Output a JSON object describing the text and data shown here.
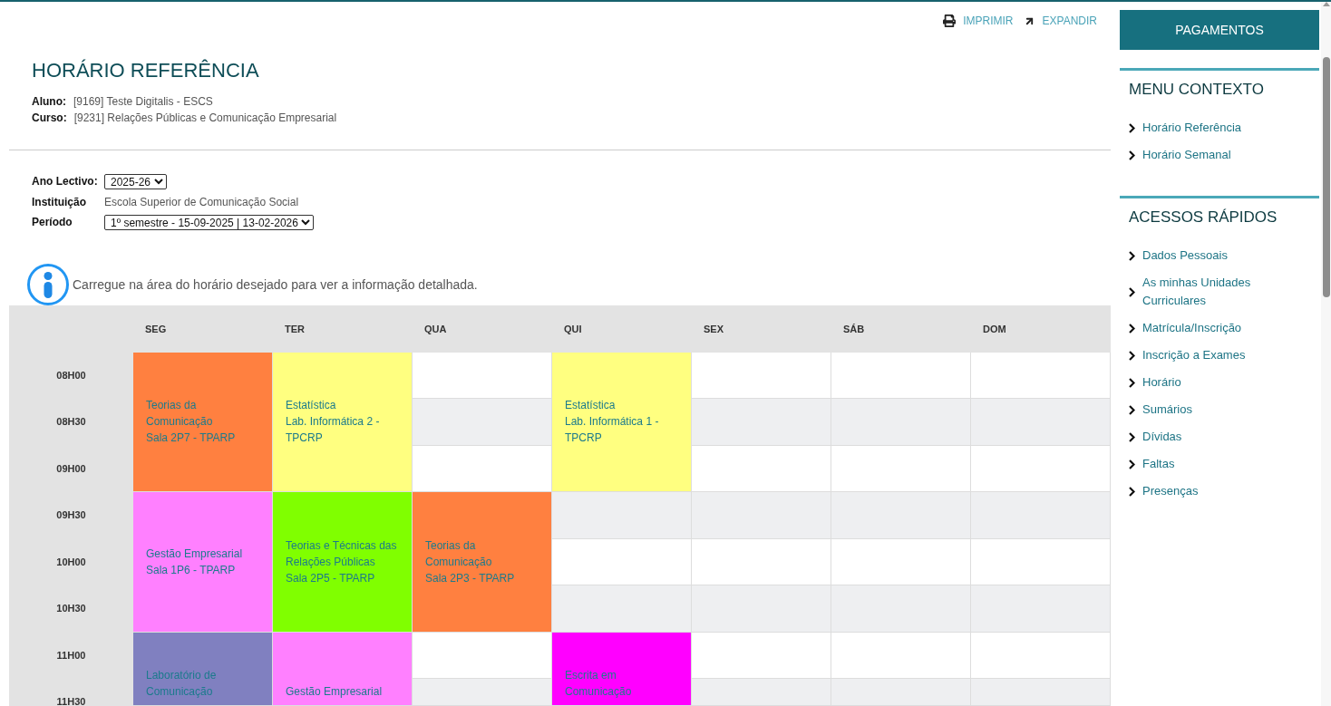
{
  "toolbar": {
    "actions": [
      {
        "kind": "print",
        "label": "IMPRIMIR"
      },
      {
        "kind": "expand",
        "label": "EXPANDIR"
      }
    ]
  },
  "page": {
    "title": "HORÁRIO REFERÊNCIA",
    "details": [
      {
        "label": "Aluno:",
        "value": "[9169] Teste Digitalis - ESCS"
      },
      {
        "label": "Curso:",
        "value": "[9231] Relações Públicas e Comunicação Empresarial"
      }
    ]
  },
  "filters": [
    {
      "kind": "select",
      "label": "Ano Lectivo:",
      "value": "2025-26"
    },
    {
      "kind": "text",
      "label": "Instituição",
      "value": "Escola Superior de Comunicação Social"
    },
    {
      "kind": "select",
      "label": "Período",
      "value": "1º semestre - 15-09-2025 | 13-02-2026"
    }
  ],
  "info": {
    "text": "Carregue na área do horário desejado para ver a informação detalhada."
  },
  "schedule": {
    "times": [
      "08H00",
      "08H30",
      "09H00",
      "09H30",
      "10H00",
      "10H30",
      "11H00",
      "11H30"
    ],
    "days": [
      {
        "label": "SEG",
        "blocks": [
          {
            "kind": "class",
            "color": "#ff8040",
            "lines": [
              "Teorias da Comunicação",
              "Sala 2P7 - TPARP"
            ]
          },
          {
            "kind": "class",
            "color": "#ff80ff",
            "lines": [
              "Gestão Empresarial",
              "Sala 1P6 - TPARP"
            ]
          },
          {
            "kind": "class",
            "color": "#8080c0",
            "lines": [
              "Laboratório de Comunicação"
            ]
          }
        ]
      },
      {
        "label": "TER",
        "blocks": [
          {
            "kind": "class",
            "color": "#ffff80",
            "lines": [
              "Estatística",
              "Lab. Informática 2 - TPCRP"
            ]
          },
          {
            "kind": "class",
            "color": "#80ff00",
            "lines": [
              "Teorias e Técnicas das Relações Públicas",
              "Sala 2P5 - TPARP"
            ]
          },
          {
            "kind": "class",
            "color": "#ff80ff",
            "lines": [
              "Gestão Empresarial"
            ]
          }
        ]
      },
      {
        "label": "QUA",
        "blocks": [
          {
            "kind": "empty"
          },
          {
            "kind": "empty"
          },
          {
            "kind": "empty"
          },
          {
            "kind": "class",
            "color": "#ff8040",
            "lines": [
              "Teorias da Comunicação",
              "Sala 2P3 - TPARP"
            ]
          },
          {
            "kind": "empty"
          },
          {
            "kind": "empty"
          }
        ]
      },
      {
        "label": "QUI",
        "blocks": [
          {
            "kind": "class",
            "color": "#ffff80",
            "lines": [
              "Estatística",
              "Lab. Informática 1 - TPCRP"
            ]
          },
          {
            "kind": "empty"
          },
          {
            "kind": "empty"
          },
          {
            "kind": "empty"
          },
          {
            "kind": "class",
            "color": "#ff00ff",
            "lines": [
              "Escrita em Comunicação"
            ]
          }
        ]
      },
      {
        "label": "SEX",
        "blocks": [
          {
            "kind": "empty"
          },
          {
            "kind": "empty"
          },
          {
            "kind": "empty"
          },
          {
            "kind": "empty"
          },
          {
            "kind": "empty"
          },
          {
            "kind": "empty"
          },
          {
            "kind": "empty"
          },
          {
            "kind": "empty"
          }
        ]
      },
      {
        "label": "SÁB",
        "blocks": [
          {
            "kind": "empty"
          },
          {
            "kind": "empty"
          },
          {
            "kind": "empty"
          },
          {
            "kind": "empty"
          },
          {
            "kind": "empty"
          },
          {
            "kind": "empty"
          },
          {
            "kind": "empty"
          },
          {
            "kind": "empty"
          }
        ]
      },
      {
        "label": "DOM",
        "blocks": [
          {
            "kind": "empty"
          },
          {
            "kind": "empty"
          },
          {
            "kind": "empty"
          },
          {
            "kind": "empty"
          },
          {
            "kind": "empty"
          },
          {
            "kind": "empty"
          },
          {
            "kind": "empty"
          },
          {
            "kind": "empty"
          }
        ]
      }
    ]
  },
  "sidebar": {
    "button": "PAGAMENTOS",
    "sections": [
      {
        "title": "MENU CONTEXTO",
        "items": [
          "Horário Referência",
          "Horário Semanal"
        ]
      },
      {
        "title": "ACESSOS RÁPIDOS",
        "items": [
          "Dados Pessoais",
          "As minhas Unidades Curriculares",
          "Matrícula/Inscrição",
          "Inscrição a Exames",
          "Horário",
          "Sumários",
          "Dívidas",
          "Faltas",
          "Presenças"
        ]
      }
    ]
  }
}
